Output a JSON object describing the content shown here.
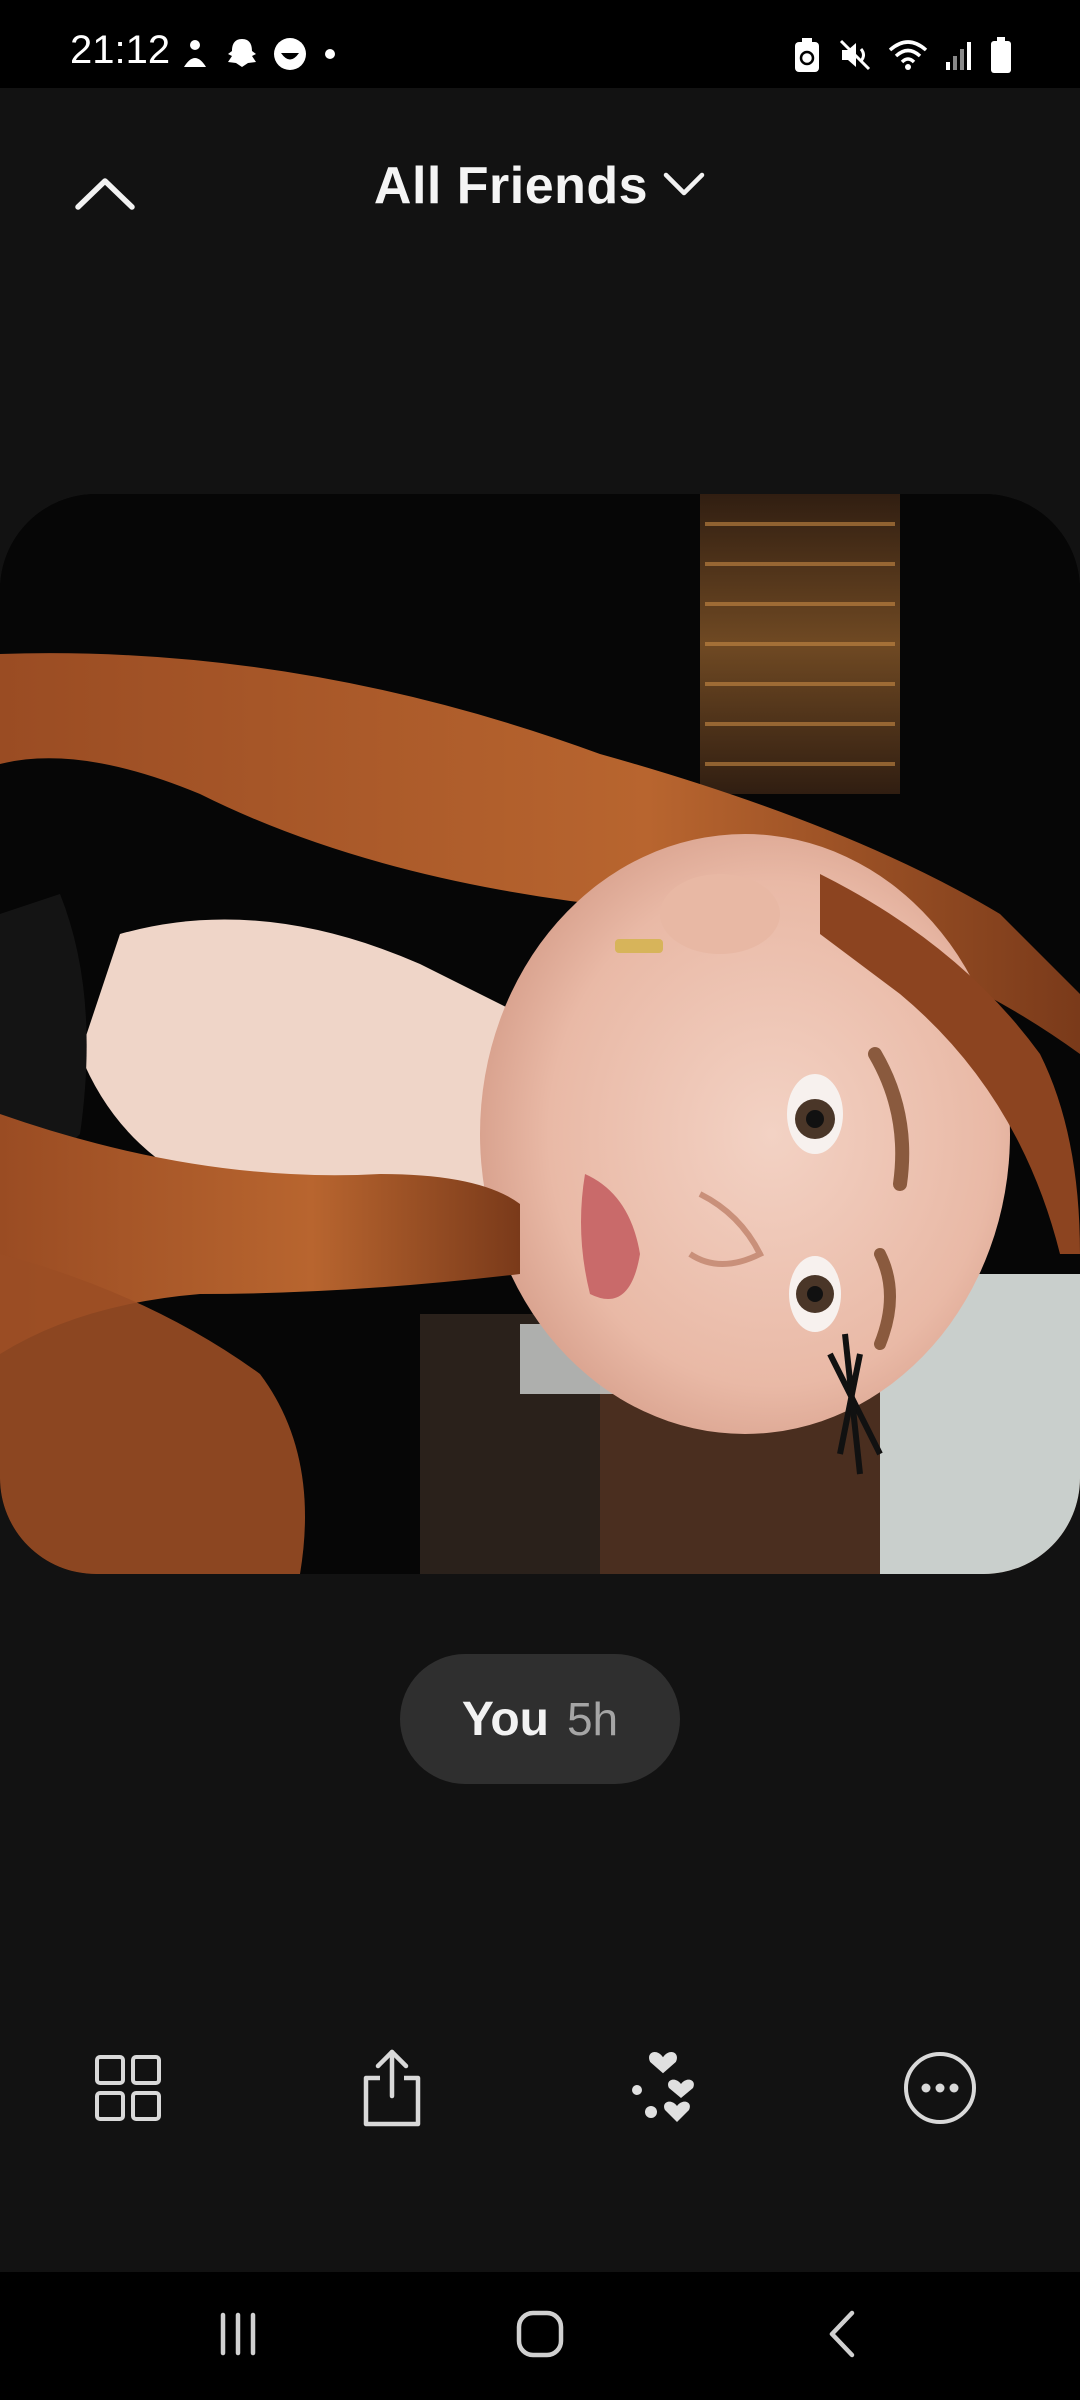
{
  "status_bar": {
    "time": "21:12",
    "left_icons": [
      "mindfulness-icon",
      "snapchat-ghost-icon",
      "smiley-app-icon",
      "notification-dot-icon"
    ],
    "right_icons": [
      "battery-saver-icon",
      "mute-icon",
      "wifi-icon",
      "signal-icon",
      "battery-icon"
    ]
  },
  "header": {
    "back_icon": "chevron-up-icon",
    "title": "All Friends",
    "dropdown_icon": "chevron-down-icon"
  },
  "post": {
    "author": "You",
    "age": "5h"
  },
  "actions": [
    {
      "name": "grid-view",
      "icon": "grid-icon"
    },
    {
      "name": "share",
      "icon": "share-icon"
    },
    {
      "name": "reactions",
      "icon": "hearts-icon"
    },
    {
      "name": "more",
      "icon": "more-icon"
    }
  ],
  "nav_bar": {
    "icons": [
      "recent-apps-icon",
      "home-icon",
      "back-icon"
    ]
  },
  "colors": {
    "background": "#121212",
    "pill": "#2f2f2f",
    "text_primary": "#f2f2f2",
    "text_secondary": "#a5a5a5"
  }
}
